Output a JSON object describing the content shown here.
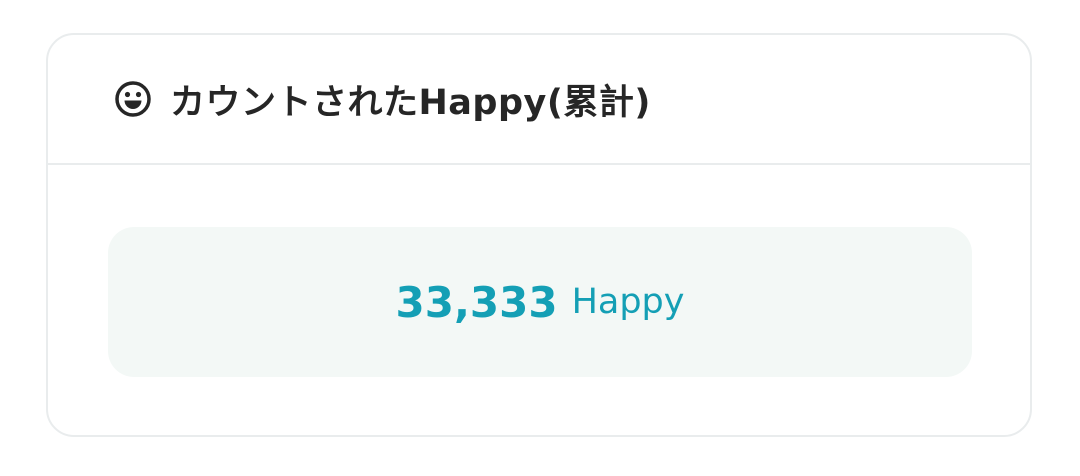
{
  "card": {
    "icon": "smiley-face-icon",
    "title": "カウントされたHappy(累計)",
    "count_value": "33,333",
    "count_unit": "Happy"
  },
  "colors": {
    "accent": "#149fb5",
    "title_text": "#262626",
    "border": "#e9eced",
    "box_background": "#f3f8f6"
  }
}
